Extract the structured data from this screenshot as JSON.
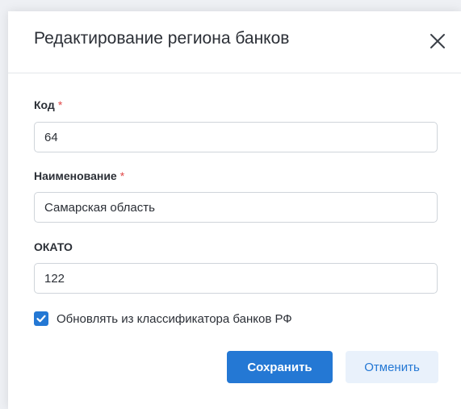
{
  "dialog": {
    "title": "Редактирование региона банков",
    "close_icon": "close-icon"
  },
  "fields": {
    "code": {
      "label": "Код",
      "required_mark": "*",
      "value": "64"
    },
    "name": {
      "label": "Наименование",
      "required_mark": "*",
      "value": "Самарская область"
    },
    "okato": {
      "label": "ОКАТО",
      "value": "122"
    }
  },
  "checkbox": {
    "label": "Обновлять из классификатора банков РФ",
    "checked": true
  },
  "buttons": {
    "save_label": "Сохранить",
    "cancel_label": "Отменить"
  },
  "colors": {
    "accent": "#2478d4",
    "required": "#e04848",
    "cancel_bg": "#e9f1fb"
  }
}
